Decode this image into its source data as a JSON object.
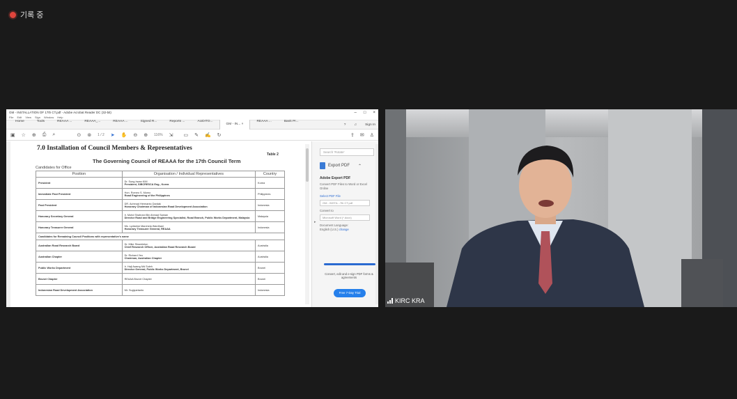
{
  "meeting": {
    "recording_label": "기록 중",
    "participant_name": "KIRC KRA"
  },
  "acrobat": {
    "title": "GM - INSTALLATION OF 17th CT.pdf - Adobe Acrobat Reader DC (32-bit)",
    "menu": [
      "File",
      "Edit",
      "View",
      "Sign",
      "Window",
      "Help"
    ],
    "tabs": [
      "Home",
      "Tools",
      "REAAA ...",
      "REAAA_...",
      "REAAA ...",
      "Signed R...",
      "Reports ...",
      "AUDITO...",
      "GM - IN... ×",
      "REAAA ...",
      "Bank Pr..."
    ],
    "active_tab": 8,
    "sign_in": "Sign In",
    "page_indicator": "1 / 2",
    "zoom": "116%",
    "doc": {
      "heading": "7.0    Installation of Council Members & Representatives",
      "table_no": "Table 2",
      "subtitle": "The Governing Council of REAAA for the 17th Council Term",
      "candidates": "Candidates for Office",
      "columns": [
        "Position",
        "Organisation / Individual Representatives",
        "Country"
      ],
      "rows": [
        {
          "position": "President",
          "line1": "Dr. Sung-hwan KIM",
          "line2": "President, SIBCRESCA Eng., Korea",
          "country": "Korea"
        },
        {
          "position": "Immediate Past President",
          "line1": "Hon. Romeo S. Momo",
          "line2": "Road Engineering of the Philippines",
          "country": "Philippines"
        },
        {
          "position": "Past President",
          "line1": "DR. Achmad Hermanto Dardak",
          "line2": "Honorary Chairman of Indonesian Road Development Association",
          "country": "Indonesia"
        },
        {
          "position": "Honorary Secretary General",
          "line1": "Ir. Mohd Shahrani Bin Ahmad Saman",
          "line2": "Director Road and Bridge Engineering Specialist, Road Branch, Public Works Department, Malaysia",
          "country": "Malaysia"
        },
        {
          "position": "Honorary Treasurer General",
          "line1": "Ms. Lydiarine Marchela Wardhani",
          "line2": "Honorary Treasurer General, REAAA",
          "country": "Indonesia"
        }
      ],
      "section_row": "Candidates for Remaining Council Positions with representative's name",
      "rows2": [
        {
          "position": "Australian Road Research Board",
          "line1": "Dr. Mike Shackleton",
          "line2": "Chief Research Officer, Australian Road Research Board",
          "country": "Australia"
        },
        {
          "position": "Australian Chapter",
          "line1": "Dr. Richard Yeo",
          "line2": "Chairman, Australian Chapter",
          "country": "Australia"
        },
        {
          "position": "Public Works Department",
          "line1": "Ir. Hajl Awang Md Soleh",
          "line2": "Director General, Public Works Department, Brunei",
          "country": "Brunei"
        },
        {
          "position": "Brunei Chapter",
          "line1": "REAAA Brunei Chapter",
          "line2": "",
          "country": "Brunei"
        },
        {
          "position": "Indonesian Road Development Association",
          "line1": "Mr. Sugiyartanto",
          "line2": "",
          "country": "Indonesia"
        }
      ]
    },
    "sidebar": {
      "search_placeholder": "Search 'Rotate'",
      "export_pdf": "Export PDF",
      "panel_title": "Adobe Export PDF",
      "panel_desc": "Convert PDF Files to Word or Excel Online",
      "select_label": "Select PDF File",
      "file_name": "GM - INSTA...7th CT.pdf",
      "convert_to": "Convert to",
      "format": "Microsoft Word (*.docx)",
      "doc_lang": "Document Language:",
      "lang_value": "English (U.S.)",
      "change": "change",
      "convert_text": "Convert, edit and e-sign PDF forms & agreements",
      "trial": "Free 7-Day Trial"
    }
  }
}
